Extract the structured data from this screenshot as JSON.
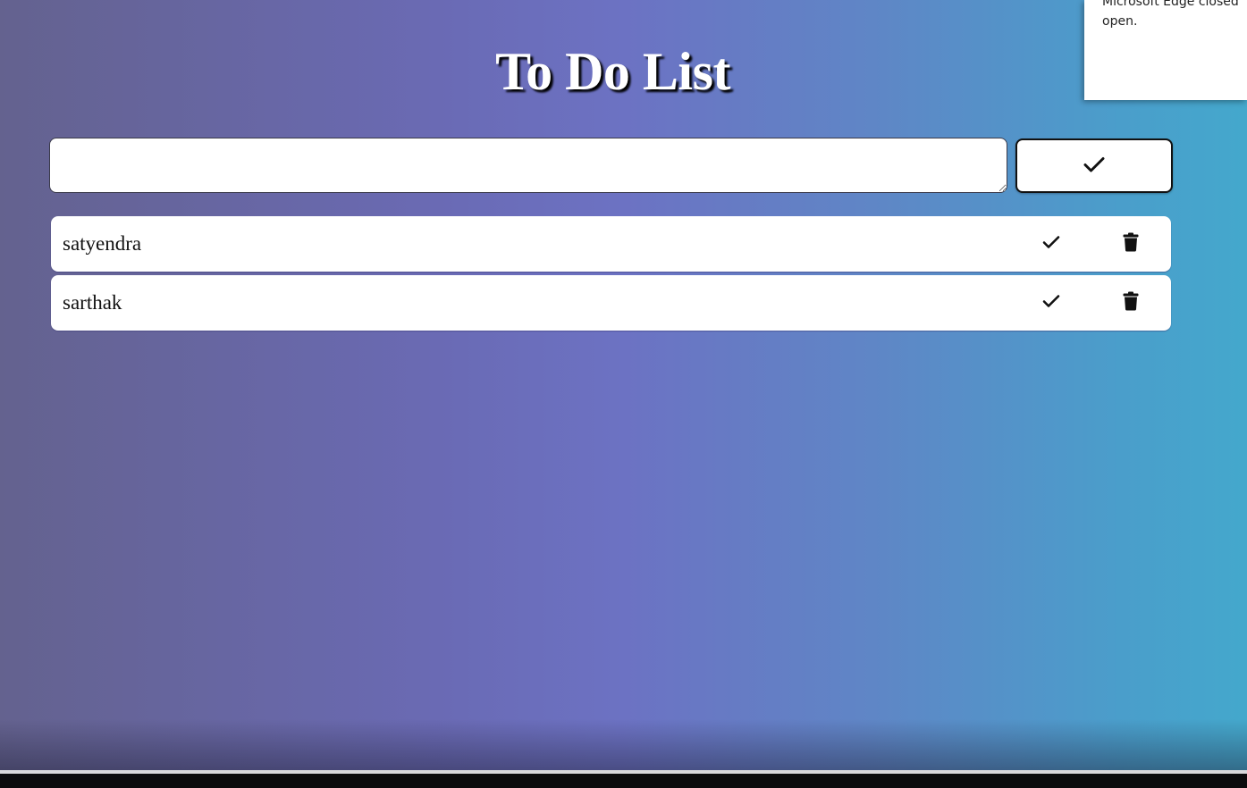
{
  "header": {
    "title": "To Do List"
  },
  "form": {
    "input_value": "",
    "input_placeholder": "",
    "add_icon": "check-icon"
  },
  "todos": [
    {
      "text": "satyendra",
      "done_icon": "check-icon",
      "delete_icon": "trash-icon"
    },
    {
      "text": "sarthak",
      "done_icon": "check-icon",
      "delete_icon": "trash-icon"
    }
  ],
  "notification": {
    "text": "Microsoft Edge closed\nopen."
  },
  "colors": {
    "gradient_left": "#64628f",
    "gradient_mid": "#6c72c3",
    "gradient_right": "#44a8cc",
    "card": "#ffffff",
    "title_text": "#ffffff",
    "title_shadow": "#000000"
  }
}
